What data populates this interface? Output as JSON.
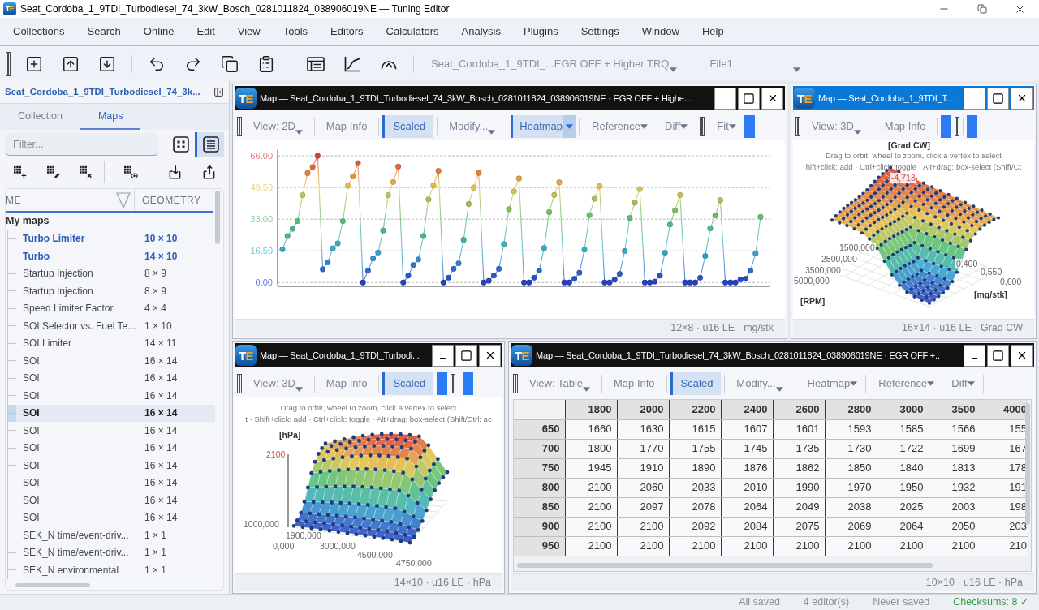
{
  "window": {
    "logo": "TE",
    "title": "Seat_Cordoba_1_9TDI_Turbodiesel_74_3kW_Bosch_0281011824_038906019NE — Tuning Editor"
  },
  "menu": [
    "Collections",
    "Search",
    "Online",
    "Edit",
    "View",
    "Tools",
    "Editors",
    "Calculators",
    "Analysis",
    "Plugins",
    "Settings",
    "Window",
    "Help"
  ],
  "toolbar": {
    "file_selector": "Seat_Cordoba_1_9TDI_...EGR OFF + Higher TRQ",
    "file_slot": "File1"
  },
  "sidebar": {
    "title": "Seat_Cordoba_1_9TDI_Turbodiesel_74_3k...",
    "tabs": [
      {
        "label": "Collection",
        "selected": false
      },
      {
        "label": "Maps",
        "selected": true
      }
    ],
    "filter": {
      "placeholder": "Filter..."
    },
    "view_modes": [
      {
        "kind": "grid",
        "selected": false
      },
      {
        "kind": "list",
        "selected": true
      }
    ],
    "columns": [
      "ME",
      "GEOMETRY"
    ],
    "groups": [
      {
        "label": "My maps",
        "children": [
          {
            "name": "Turbo Limiter",
            "geometry": "10 × 10",
            "open": true,
            "selected": false
          },
          {
            "name": "Turbo",
            "geometry": "14 × 10",
            "open": true,
            "selected": false
          },
          {
            "name": "Startup Injection",
            "geometry": "8 × 9",
            "open": false,
            "selected": false
          },
          {
            "name": "Startup Injection",
            "geometry": "8 × 9",
            "open": false,
            "selected": false
          },
          {
            "name": "Speed Limiter Factor",
            "geometry": "4 × 4",
            "open": false,
            "selected": false
          },
          {
            "name": "SOI Selector vs. Fuel Te...",
            "geometry": "1 × 10",
            "open": false,
            "selected": false
          },
          {
            "name": "SOI Limiter",
            "geometry": "14 × 11",
            "open": false,
            "selected": false
          },
          {
            "name": "SOI",
            "geometry": "16 × 14",
            "open": false,
            "selected": false
          },
          {
            "name": "SOI",
            "geometry": "16 × 14",
            "open": false,
            "selected": false
          },
          {
            "name": "SOI",
            "geometry": "16 × 14",
            "open": false,
            "selected": false
          },
          {
            "name": "SOI",
            "geometry": "16 × 14",
            "open": false,
            "selected": true
          },
          {
            "name": "SOI",
            "geometry": "16 × 14",
            "open": false,
            "selected": false
          },
          {
            "name": "SOI",
            "geometry": "16 × 14",
            "open": false,
            "selected": false
          },
          {
            "name": "SOI",
            "geometry": "16 × 14",
            "open": false,
            "selected": false
          },
          {
            "name": "SOI",
            "geometry": "16 × 14",
            "open": false,
            "selected": false
          },
          {
            "name": "SOI",
            "geometry": "16 × 14",
            "open": false,
            "selected": false
          },
          {
            "name": "SOI",
            "geometry": "16 × 14",
            "open": false,
            "selected": false
          },
          {
            "name": "SEK_N time/event-driv...",
            "geometry": "1 × 1",
            "open": false,
            "selected": false
          },
          {
            "name": "SEK_N time/event-driv...",
            "geometry": "1 × 1",
            "open": false,
            "selected": false
          },
          {
            "name": "SEK_N environmental",
            "geometry": "1 × 1",
            "open": false,
            "selected": false
          }
        ]
      }
    ]
  },
  "editors": [
    {
      "kind": "line_chart",
      "logo": "TE",
      "title": "Map — Seat_Cordoba_1_9TDI_Turbodiesel_74_3kW_Bosch_0281011824_038906019NE · EGR OFF + Highe...",
      "active": false,
      "toolbar": [
        {
          "kind": "grip"
        },
        {
          "kind": "combo",
          "label": "View: 2D"
        },
        {
          "kind": "separator"
        },
        {
          "kind": "button",
          "label": "Map Info"
        },
        {
          "kind": "separator"
        },
        {
          "kind": "toggle",
          "label": "Scaled",
          "on": true
        },
        {
          "kind": "separator"
        },
        {
          "kind": "combo",
          "label": "Modify..."
        },
        {
          "kind": "separator"
        },
        {
          "kind": "menu",
          "label": "Heatmap",
          "on": true
        },
        {
          "kind": "separator"
        },
        {
          "kind": "menu",
          "label": "Reference",
          "on": false
        },
        {
          "kind": "menu",
          "label": "Diff",
          "on": false
        },
        {
          "kind": "separator"
        },
        {
          "kind": "grip"
        },
        {
          "kind": "menu",
          "label": "Fit",
          "on": false
        },
        {
          "kind": "swatch"
        }
      ],
      "chart_data": {
        "type": "line",
        "grid": true,
        "ylim": [
          -2,
          69
        ],
        "yticks": [
          {
            "value": 0,
            "label": "0.00"
          },
          {
            "value": 16.5,
            "label": "16.50"
          },
          {
            "value": 33,
            "label": "33.00"
          },
          {
            "value": 49.5,
            "label": "49.50"
          },
          {
            "value": 66,
            "label": "66.00"
          }
        ],
        "series": [
          {
            "marker": "circle",
            "values": [
              17.3,
              24.2,
              28,
              32,
              45.5,
              57,
              60.2,
              66,
              6.9,
              10.5,
              17.8,
              20.4,
              32,
              50.4,
              55.3,
              62.2,
              0,
              6.2,
              12.5,
              15.6,
              27.1,
              45.5,
              52.4,
              60.4,
              0,
              3.6,
              9.1,
              12,
              24.2,
              43.3,
              50.5,
              58.2,
              0,
              2.5,
              7.1,
              10,
              22.2,
              40.9,
              49.5,
              57.1,
              0,
              0.9,
              3.6,
              7.1,
              20,
              38.2,
              47.5,
              54.2,
              0,
              0,
              2.5,
              6.2,
              18,
              36.7,
              45.6,
              52.2,
              0,
              0,
              2,
              5.1,
              17.1,
              35.1,
              43.6,
              50.2,
              0,
              0,
              1.5,
              4.5,
              16.4,
              33.6,
              41.6,
              48.7,
              0,
              0,
              0.5,
              3.6,
              15.5,
              30.2,
              37.6,
              45.6,
              0,
              0,
              0,
              2.5,
              13.8,
              28.2,
              34.9,
              42.9,
              0,
              0,
              0,
              1.6,
              2,
              6.2,
              15.1,
              34.2
            ]
          }
        ]
      },
      "footer": "12×8 · u16 LE · mg/stk"
    },
    {
      "kind": "surface",
      "logo": "TE",
      "title": "Map — Seat_Cordoba_1_9TDI_T...",
      "active": true,
      "toolbar": [
        {
          "kind": "grip"
        },
        {
          "kind": "combo",
          "label": "View: 3D"
        },
        {
          "kind": "separator"
        },
        {
          "kind": "button",
          "label": "Map Info"
        },
        {
          "kind": "separator"
        },
        {
          "kind": "swatch"
        },
        {
          "kind": "grip"
        },
        {
          "kind": "separator"
        },
        {
          "kind": "swatch"
        }
      ],
      "hints": [
        "Drag to orbit, wheel to zoom, click a vertex to select",
        "hift+click: add · Ctrl+click: toggle · Alt+drag: box-select (Shift/Ct"
      ],
      "labels": [
        {
          "text": "[Grad CW]",
          "kind": "unit"
        },
        {
          "text": "-4,713",
          "kind": "peak"
        },
        {
          "text": "1500,000",
          "kind": "tick"
        },
        {
          "text": "2500,000",
          "kind": "tick"
        },
        {
          "text": "3500,000",
          "kind": "tick"
        },
        {
          "text": "5000,000",
          "kind": "tick"
        },
        {
          "text": "0,400",
          "kind": "tick"
        },
        {
          "text": "0,550",
          "kind": "tick"
        },
        {
          "text": "0,600",
          "kind": "tick"
        },
        {
          "text": "[mg/stk]",
          "kind": "unit"
        },
        {
          "text": "[RPM]",
          "kind": "unit"
        }
      ],
      "footer": "16×14 · u16 LE · Grad CW"
    },
    {
      "kind": "surface",
      "logo": "TE",
      "title": "Map — Seat_Cordoba_1_9TDI_Turbodi...",
      "active": false,
      "toolbar": [
        {
          "kind": "grip"
        },
        {
          "kind": "combo",
          "label": "View: 3D"
        },
        {
          "kind": "separator"
        },
        {
          "kind": "button",
          "label": "Map Info"
        },
        {
          "kind": "separator"
        },
        {
          "kind": "toggle",
          "label": "Scaled",
          "on": true
        },
        {
          "kind": "swatch"
        },
        {
          "kind": "grip"
        },
        {
          "kind": "separator"
        },
        {
          "kind": "swatch"
        }
      ],
      "hints": [
        "Drag to orbit, wheel to zoom, click a vertex to select",
        "t · Shift+click: add · Ctrl+click: toggle · Alt+drag: box-select (Shift/Ctrl: ac"
      ],
      "labels": [
        {
          "text": "[hPa]",
          "kind": "unit"
        },
        {
          "text": "2100",
          "kind": "peak"
        },
        {
          "text": "1000,000",
          "kind": "tick"
        },
        {
          "text": "1900,000",
          "kind": "tick"
        },
        {
          "text": "0,000",
          "kind": "tick"
        },
        {
          "text": "3000,000",
          "kind": "tick"
        },
        {
          "text": "4500,000",
          "kind": "tick"
        },
        {
          "text": "4750,000",
          "kind": "tick"
        }
      ],
      "footer": "14×10 · u16 LE · hPa"
    },
    {
      "kind": "table",
      "logo": "TE",
      "title": "Map — Seat_Cordoba_1_9TDI_Turbodiesel_74_3kW_Bosch_0281011824_038906019NE · EGR OFF +..",
      "active": false,
      "toolbar": [
        {
          "kind": "grip"
        },
        {
          "kind": "combo",
          "label": "View: Table"
        },
        {
          "kind": "separator"
        },
        {
          "kind": "button",
          "label": "Map Info"
        },
        {
          "kind": "separator"
        },
        {
          "kind": "toggle",
          "label": "Scaled",
          "on": true
        },
        {
          "kind": "separator"
        },
        {
          "kind": "combo",
          "label": "Modify..."
        },
        {
          "kind": "separator"
        },
        {
          "kind": "menu",
          "label": "Heatmap",
          "on": false
        },
        {
          "kind": "separator"
        },
        {
          "kind": "menu",
          "label": "Reference",
          "on": false
        },
        {
          "kind": "menu",
          "label": "Diff",
          "on": false
        },
        {
          "kind": "separator"
        }
      ],
      "columns": [
        "1800",
        "2000",
        "2200",
        "2400",
        "2600",
        "2800",
        "3000",
        "3500",
        "4000"
      ],
      "rows": [
        {
          "label": "650",
          "cells": [
            "1660",
            "1630",
            "1615",
            "1607",
            "1601",
            "1593",
            "1585",
            "1566",
            "155"
          ]
        },
        {
          "label": "700",
          "cells": [
            "1800",
            "1770",
            "1755",
            "1745",
            "1735",
            "1730",
            "1722",
            "1699",
            "167"
          ]
        },
        {
          "label": "750",
          "cells": [
            "1945",
            "1910",
            "1890",
            "1876",
            "1862",
            "1850",
            "1840",
            "1813",
            "178"
          ]
        },
        {
          "label": "800",
          "cells": [
            "2100",
            "2060",
            "2033",
            "2010",
            "1990",
            "1970",
            "1950",
            "1932",
            "191"
          ]
        },
        {
          "label": "850",
          "cells": [
            "2100",
            "2097",
            "2078",
            "2064",
            "2049",
            "2038",
            "2025",
            "2003",
            "198"
          ]
        },
        {
          "label": "900",
          "cells": [
            "2100",
            "2100",
            "2092",
            "2084",
            "2075",
            "2069",
            "2064",
            "2050",
            "203"
          ]
        },
        {
          "label": "950",
          "cells": [
            "2100",
            "2100",
            "2100",
            "2100",
            "2100",
            "2100",
            "2100",
            "2100",
            "210"
          ]
        }
      ],
      "footer": "10×10 · u16 LE · hPa"
    }
  ],
  "status_bar": {
    "items": [
      "All saved",
      "4 editor(s)",
      "Never saved"
    ],
    "checksums": "Checksums: 8 ✓"
  }
}
